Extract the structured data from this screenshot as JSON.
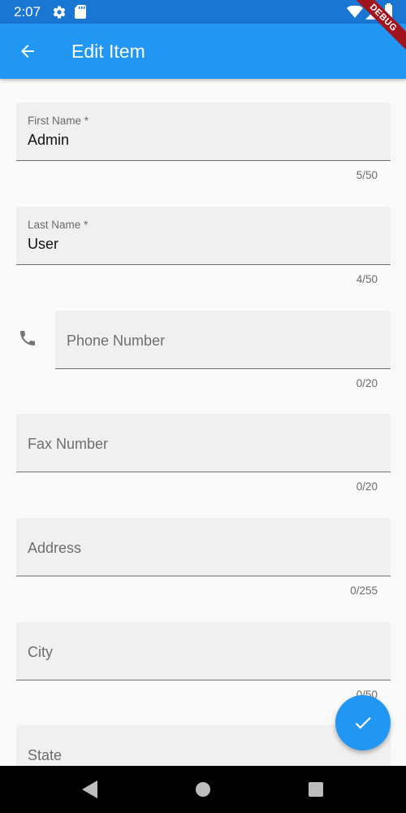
{
  "status_bar": {
    "time": "2:07"
  },
  "debug_banner": "DEBUG",
  "app_bar": {
    "title": "Edit Item"
  },
  "form": {
    "first_name": {
      "label": "First Name *",
      "value": "Admin",
      "counter": "5/50"
    },
    "last_name": {
      "label": "Last Name *",
      "value": "User",
      "counter": "4/50"
    },
    "phone": {
      "placeholder": "Phone Number",
      "counter": "0/20"
    },
    "fax": {
      "placeholder": "Fax Number",
      "counter": "0/20"
    },
    "address": {
      "placeholder": "Address",
      "counter": "0/255"
    },
    "city": {
      "placeholder": "City",
      "counter": "0/50"
    },
    "state": {
      "placeholder": "State"
    }
  },
  "colors": {
    "app_bar": "#2196f3",
    "status_bar": "#1976d2",
    "fab": "#2196f3",
    "debug": "#a0141c"
  },
  "icons": {
    "back": "arrow-back-icon",
    "phone": "phone-icon",
    "fab": "check-icon"
  }
}
